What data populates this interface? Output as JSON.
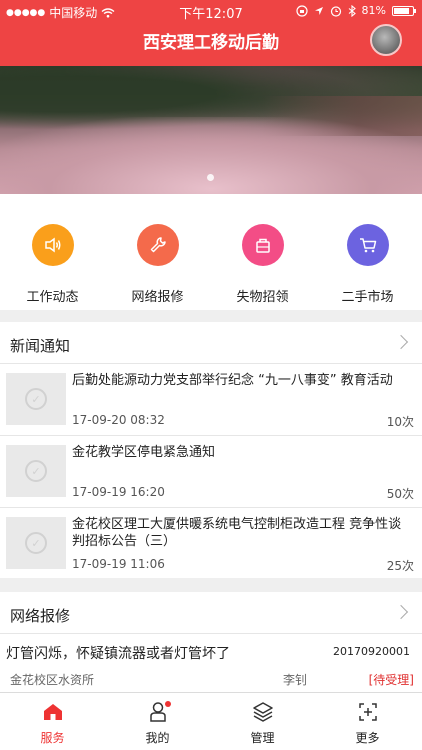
{
  "status_bar": {
    "carrier": "中国移动",
    "time": "下午12:07",
    "battery": "81%",
    "battery_level": 0.81
  },
  "nav": {
    "title": "西安理工移动后勤"
  },
  "banner": {
    "page_indicator_count": 1
  },
  "quick_menu": [
    {
      "label": "工作动态",
      "icon": "speaker-icon",
      "color": "#fa9f1b"
    },
    {
      "label": "网络报修",
      "icon": "wrench-icon",
      "color": "#f46a4b"
    },
    {
      "label": "失物招领",
      "icon": "bag-icon",
      "color": "#f34d86"
    },
    {
      "label": "二手市场",
      "icon": "cart-icon",
      "color": "#6c63e0"
    }
  ],
  "news": {
    "title": "新闻通知",
    "items": [
      {
        "title": "后勤处能源动力党支部举行纪念 “九一八事变” 教育活动",
        "date": "17-09-20 08:32",
        "count": "10次"
      },
      {
        "title": "金花教学区停电紧急通知",
        "date": "17-09-19 16:20",
        "count": "50次"
      },
      {
        "title": "金花校区理工大厦供暖系统电气控制柜改造工程 竞争性谈判招标公告（三）",
        "date": "17-09-19 11:06",
        "count": "25次"
      }
    ]
  },
  "repair": {
    "title": "网络报修",
    "items": [
      {
        "title": "灯管闪烁，怀疑镇流器或者灯管坏了",
        "id": "20170920001",
        "place": "金花校区水资所",
        "person": "李钊",
        "status": "[待受理]"
      }
    ]
  },
  "tabbar": [
    {
      "label": "服务",
      "icon": "home-icon",
      "active": true
    },
    {
      "label": "我的",
      "icon": "person-icon",
      "active": false,
      "badge": true
    },
    {
      "label": "管理",
      "icon": "layers-icon",
      "active": false
    },
    {
      "label": "更多",
      "icon": "plus-square-icon",
      "active": false
    }
  ],
  "colors": {
    "brand_red": "#ee4444",
    "status_red": "#e03030"
  }
}
